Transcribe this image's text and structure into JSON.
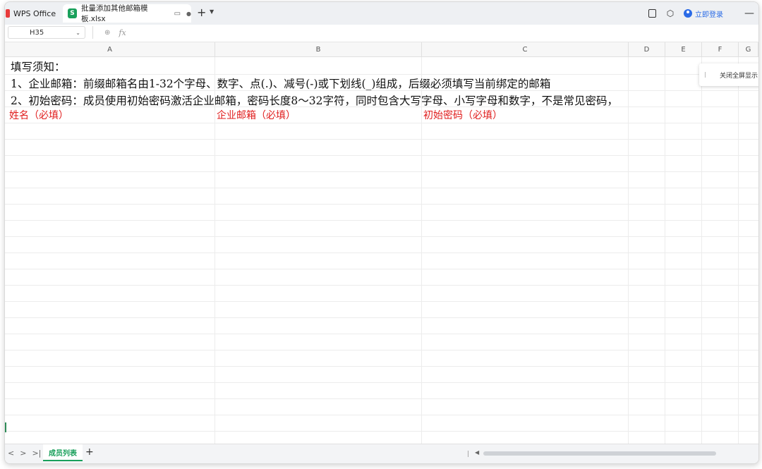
{
  "titlebar": {
    "app_name": "WPS Office",
    "doc_tab": "批量添加其他邮箱模板.xlsx",
    "login": "立即登录"
  },
  "formula_bar": {
    "cell_ref": "H35",
    "fx_label": "fx"
  },
  "sheet": {
    "columns": [
      "A",
      "B",
      "C",
      "D",
      "E",
      "F",
      "G"
    ],
    "rows": {
      "r1": "填写须知：",
      "r2": "1、企业邮箱：前缀邮箱名由1-32个字母、数字、点(.)、减号(-)或下划线(_)组成，后缀必须填写当前绑定的邮箱",
      "r3": "2、初始密码：成员使用初始密码激活企业邮箱，密码长度8～32字符，同时包含大写字母、小写字母和数字，不是常见密码，"
    },
    "header_row": [
      "姓名（必填）",
      "企业邮箱（必填）",
      "初始密码（必填）"
    ],
    "popup": "关闭全屏显示"
  },
  "bottom": {
    "sheet_tab": "成员列表",
    "add": "+"
  },
  "colors": {
    "accent_green": "#19a05b",
    "required_red": "#e01d1d",
    "login_blue": "#2b6be6"
  }
}
